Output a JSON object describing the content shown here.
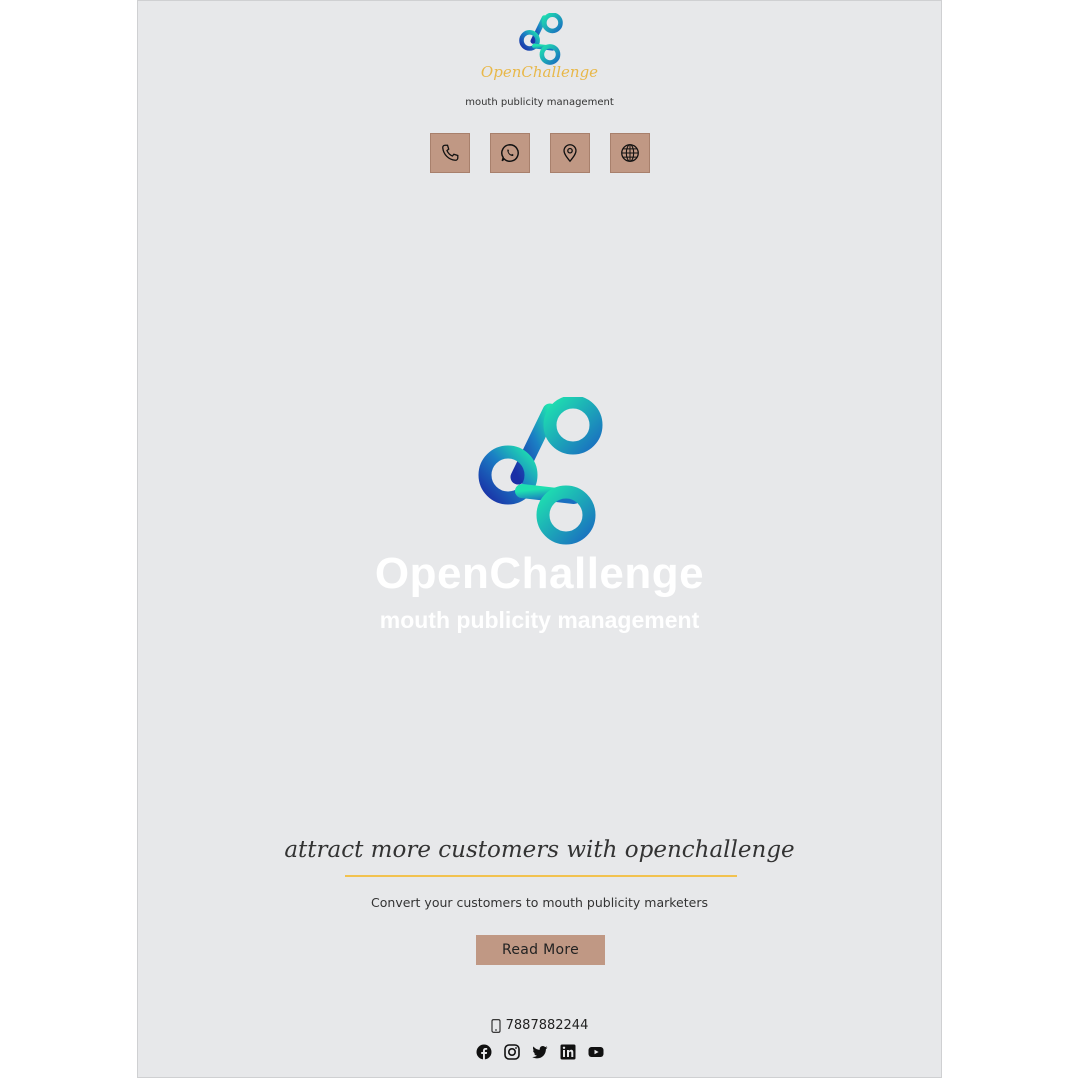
{
  "header": {
    "brand_name": "OpenChallenge",
    "tagline": "mouth publicity management"
  },
  "contact_icons": [
    {
      "name": "phone-icon"
    },
    {
      "name": "whatsapp-icon"
    },
    {
      "name": "location-pin-icon"
    },
    {
      "name": "globe-icon"
    }
  ],
  "hero": {
    "title": "OpenChallenge",
    "subtitle": "mouth publicity management"
  },
  "promo": {
    "heading": "attract more customers with openchallenge",
    "body": "Convert your customers to mouth publicity marketers",
    "button_label": "Read More"
  },
  "footer": {
    "phone": "7887882244",
    "social_icons": [
      "facebook-icon",
      "instagram-icon",
      "twitter-icon",
      "linkedin-icon",
      "youtube-icon"
    ]
  },
  "colors": {
    "background": "#e7e8ea",
    "accent": "#c09884",
    "gold": "#f2c24f",
    "brand_script": "#e8b84a",
    "logo_teal": "#1dd9b0",
    "logo_blue": "#1e3fae"
  }
}
